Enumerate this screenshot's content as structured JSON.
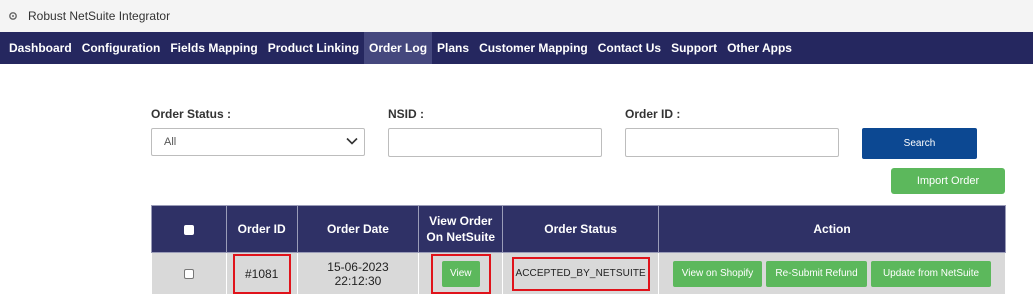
{
  "window": {
    "title": "Robust NetSuite Integrator",
    "icon": "gear-icon"
  },
  "nav": {
    "items": [
      {
        "label": "Dashboard"
      },
      {
        "label": "Configuration"
      },
      {
        "label": "Fields Mapping"
      },
      {
        "label": "Product Linking"
      },
      {
        "label": "Order Log",
        "active": true
      },
      {
        "label": "Plans"
      },
      {
        "label": "Customer Mapping"
      },
      {
        "label": "Contact Us"
      },
      {
        "label": "Support"
      },
      {
        "label": "Other Apps"
      }
    ],
    "bg_color": "#25275f",
    "active_color": "#45487e"
  },
  "filters": {
    "order_status_label": "Order Status :",
    "order_status_value": "All",
    "nsid_label": "NSID :",
    "nsid_value": "",
    "order_id_label": "Order ID :",
    "order_id_value": "",
    "search_label": "Search",
    "import_label": "Import Order"
  },
  "table": {
    "headers": {
      "order_id": "Order ID",
      "order_date": "Order Date",
      "view_line1": "View Order",
      "view_line2": "On NetSuite",
      "order_status": "Order Status",
      "action": "Action"
    },
    "rows": [
      {
        "order_id": "#1081",
        "date_line1": "15-06-2023",
        "date_line2": "22:12:30",
        "view_label": "View",
        "status": "ACCEPTED_BY_NETSUITE",
        "actions": {
          "view_shopify": "View on Shopify",
          "resubmit_refund": "Re-Submit Refund",
          "update_netsuite": "Update from NetSuite"
        }
      }
    ]
  },
  "colors": {
    "header": "#2f3166",
    "primary_button": "#0c4892",
    "success_button": "#5cb85c",
    "highlight": "#e0131b"
  }
}
